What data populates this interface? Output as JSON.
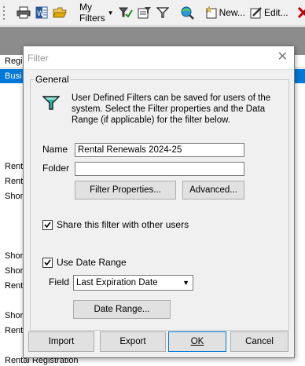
{
  "toolbar": {
    "my_filters_label": "My Filters",
    "new_label": "New...",
    "edit_label": "Edit..."
  },
  "background": {
    "header_row_text": "Regi",
    "selected_row_text": "Busi",
    "rows": [
      "Rent",
      "Rent",
      "Shor",
      "Shor",
      "Shor",
      "Rent",
      "Shor",
      "Rent",
      "Rental Registration"
    ]
  },
  "dialog": {
    "title": "Filter",
    "group_title": "General",
    "description": "User Defined Filters can be saved for users of the system. Select the Filter properties and the Data Range (if applicable) for the filter below.",
    "name_label": "Name",
    "name_value": "Rental Renewals 2024-25",
    "folder_label": "Folder",
    "folder_value": "",
    "filter_properties_label": "Filter Properties...",
    "advanced_label": "Advanced...",
    "share_label": "Share this filter with other users",
    "share_checked": true,
    "use_date_range_label": "Use Date Range",
    "use_date_range_checked": true,
    "field_label": "Field",
    "field_value": "Last Expiration Date",
    "date_range_label": "Date Range...",
    "import_label": "Import",
    "export_label": "Export",
    "ok_label": "OK",
    "cancel_label": "Cancel"
  },
  "colors": {
    "selection_blue": "#0078d7",
    "gray_band": "#8c8c8c",
    "funnel_teal": "#1a8a8a"
  }
}
